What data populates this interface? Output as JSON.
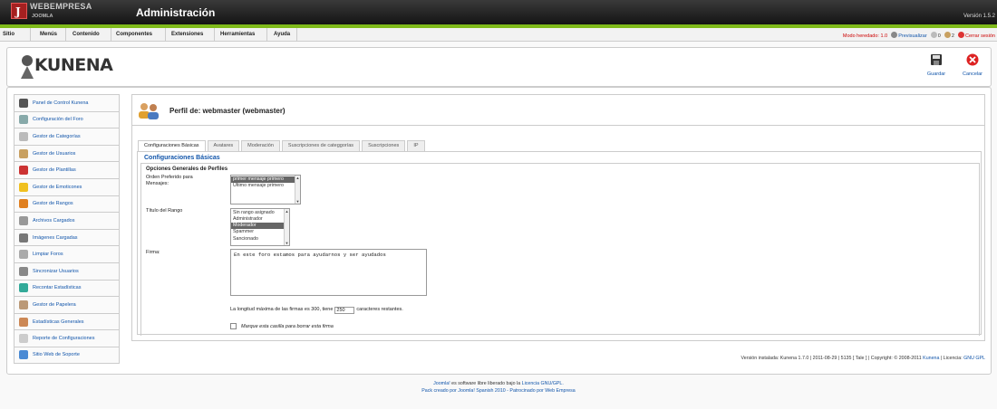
{
  "header": {
    "logo_letter": "J",
    "brand": "WEBEMPRESA",
    "brand_sub": "JOOMLA",
    "title": "Administración",
    "version": "Versión 1.5.2"
  },
  "menu": [
    "Sitio",
    "Menús",
    "Contenido",
    "Componentes",
    "Extensiones",
    "Herramientas",
    "Ayuda"
  ],
  "status": {
    "mode": "Modo heredado: 1.0",
    "preview": "Previsualizar",
    "messages": "0",
    "users": "2",
    "logout": "Cerrar sesión"
  },
  "toolbar": {
    "logo": "KUNENA",
    "save": "Guardar",
    "cancel": "Cancelar"
  },
  "sidebar": {
    "items": [
      {
        "label": "Panel de Control Kunena",
        "icon": "kunena-icon",
        "color": "#555"
      },
      {
        "label": "Configuración del Foro",
        "icon": "tools-icon",
        "color": "#8aa"
      },
      {
        "label": "Gestor de Categorías",
        "icon": "categories-icon",
        "color": "#bbb"
      },
      {
        "label": "Gestor de Usuarios",
        "icon": "users-icon",
        "color": "#c8a060"
      },
      {
        "label": "Gestor de Plantillas",
        "icon": "templates-icon",
        "color": "#c33"
      },
      {
        "label": "Gestor de Emoticones",
        "icon": "smiley-icon",
        "color": "#f0c020"
      },
      {
        "label": "Gestor de Rangos",
        "icon": "rank-star-icon",
        "color": "#e08020"
      },
      {
        "label": "Archivos Cargados",
        "icon": "files-icon",
        "color": "#999"
      },
      {
        "label": "Imágenes Cargadas",
        "icon": "images-icon",
        "color": "#777"
      },
      {
        "label": "Limpiar Foros",
        "icon": "clean-icon",
        "color": "#aaa"
      },
      {
        "label": "Sincronizar Usuarios",
        "icon": "sync-users-icon",
        "color": "#888"
      },
      {
        "label": "Recontar Estadísticas",
        "icon": "recount-icon",
        "color": "#3a9"
      },
      {
        "label": "Gestor de Papelera",
        "icon": "trash-icon",
        "color": "#b97"
      },
      {
        "label": "Estadísticas Generales",
        "icon": "stats-icon",
        "color": "#c85"
      },
      {
        "label": "Reporte de Configuraciones",
        "icon": "report-icon",
        "color": "#ccc"
      },
      {
        "label": "Sitio Web de Soporte",
        "icon": "support-globe-icon",
        "color": "#4a8ad4"
      }
    ]
  },
  "profile": {
    "title": "Perfil de: webmaster (webmaster)",
    "tabs": [
      "Configuraciones Básicas",
      "Avatares",
      "Moderación",
      "Suscripciones de categgorías",
      "Suscripciones",
      "IP"
    ],
    "active_tab": 0,
    "section_title": "Configuraciones Básicas",
    "legend": "Opciones Generales de Perfiles",
    "order_label": "Orden Preferido para Mensajes:",
    "order_options": [
      "primer mensaje primero",
      "Último mensaje primero"
    ],
    "order_selected": 0,
    "rank_label": "Título del Rango",
    "rank_options": [
      "Sin rango asignado",
      "Administrador",
      "Moderador",
      "Spammer",
      "Sancionado"
    ],
    "rank_selected": 2,
    "signature_label": "Firma:",
    "signature": "En este foro estamos para ayudarnos y ser ayudados",
    "length_prefix": "La longitud máxima de las firmas es 300, tiene",
    "length_value": "250",
    "length_suffix": "caracteres restantes.",
    "delete_label": "Marque esta casilla para borrar esta firma"
  },
  "installed": {
    "text": "Versión instalada: Kunena 1.7.0 | 2011-08-29 | 5135 [ Tale ] | Copyright: © 2008-2011",
    "kunena_link": "Kunena",
    "license": "| Licencia:",
    "gpl_link": "GNU GPL"
  },
  "footer": {
    "joomla_link": "Joomla!",
    "line1_mid": "es software libre liberado bajo la",
    "license_link": "Licencia GNU/GPL.",
    "line2": "Pack creado por Joomla! Spanish 2010 - Patrocinado por Web Empresa"
  },
  "colors": {
    "accent_green": "#7fba1a",
    "link_blue": "#1155aa",
    "header_dark": "#1e1e1e"
  }
}
